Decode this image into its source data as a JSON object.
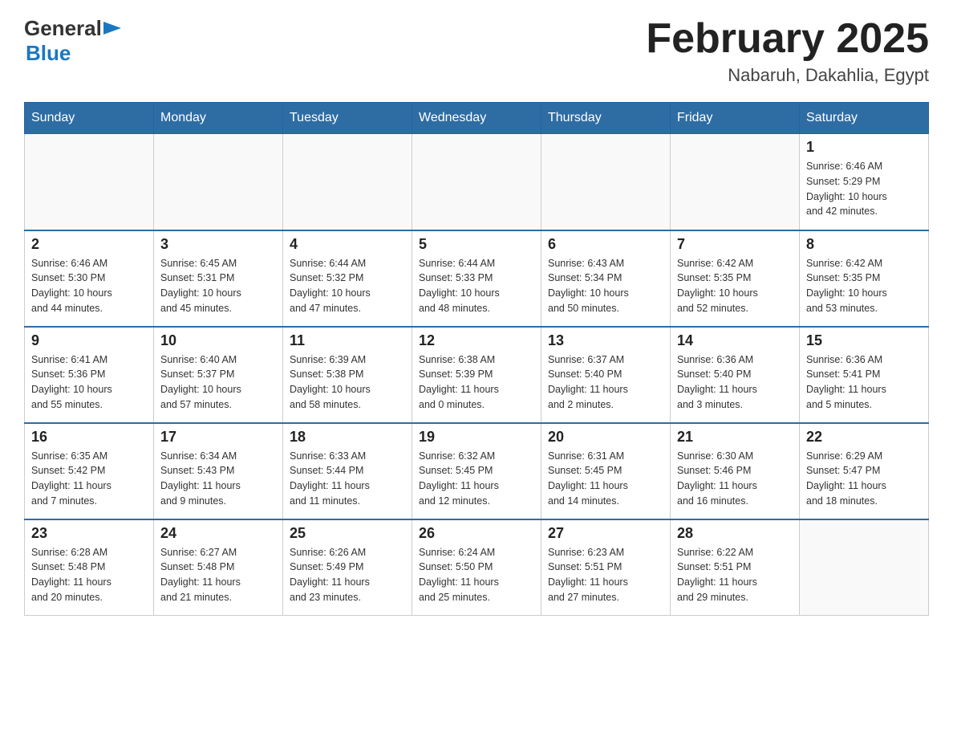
{
  "header": {
    "title": "February 2025",
    "subtitle": "Nabaruh, Dakahlia, Egypt",
    "logo_general": "General",
    "logo_blue": "Blue"
  },
  "days_of_week": [
    "Sunday",
    "Monday",
    "Tuesday",
    "Wednesday",
    "Thursday",
    "Friday",
    "Saturday"
  ],
  "weeks": [
    {
      "cells": [
        {
          "day": "",
          "info": ""
        },
        {
          "day": "",
          "info": ""
        },
        {
          "day": "",
          "info": ""
        },
        {
          "day": "",
          "info": ""
        },
        {
          "day": "",
          "info": ""
        },
        {
          "day": "",
          "info": ""
        },
        {
          "day": "1",
          "info": "Sunrise: 6:46 AM\nSunset: 5:29 PM\nDaylight: 10 hours\nand 42 minutes."
        }
      ]
    },
    {
      "cells": [
        {
          "day": "2",
          "info": "Sunrise: 6:46 AM\nSunset: 5:30 PM\nDaylight: 10 hours\nand 44 minutes."
        },
        {
          "day": "3",
          "info": "Sunrise: 6:45 AM\nSunset: 5:31 PM\nDaylight: 10 hours\nand 45 minutes."
        },
        {
          "day": "4",
          "info": "Sunrise: 6:44 AM\nSunset: 5:32 PM\nDaylight: 10 hours\nand 47 minutes."
        },
        {
          "day": "5",
          "info": "Sunrise: 6:44 AM\nSunset: 5:33 PM\nDaylight: 10 hours\nand 48 minutes."
        },
        {
          "day": "6",
          "info": "Sunrise: 6:43 AM\nSunset: 5:34 PM\nDaylight: 10 hours\nand 50 minutes."
        },
        {
          "day": "7",
          "info": "Sunrise: 6:42 AM\nSunset: 5:35 PM\nDaylight: 10 hours\nand 52 minutes."
        },
        {
          "day": "8",
          "info": "Sunrise: 6:42 AM\nSunset: 5:35 PM\nDaylight: 10 hours\nand 53 minutes."
        }
      ]
    },
    {
      "cells": [
        {
          "day": "9",
          "info": "Sunrise: 6:41 AM\nSunset: 5:36 PM\nDaylight: 10 hours\nand 55 minutes."
        },
        {
          "day": "10",
          "info": "Sunrise: 6:40 AM\nSunset: 5:37 PM\nDaylight: 10 hours\nand 57 minutes."
        },
        {
          "day": "11",
          "info": "Sunrise: 6:39 AM\nSunset: 5:38 PM\nDaylight: 10 hours\nand 58 minutes."
        },
        {
          "day": "12",
          "info": "Sunrise: 6:38 AM\nSunset: 5:39 PM\nDaylight: 11 hours\nand 0 minutes."
        },
        {
          "day": "13",
          "info": "Sunrise: 6:37 AM\nSunset: 5:40 PM\nDaylight: 11 hours\nand 2 minutes."
        },
        {
          "day": "14",
          "info": "Sunrise: 6:36 AM\nSunset: 5:40 PM\nDaylight: 11 hours\nand 3 minutes."
        },
        {
          "day": "15",
          "info": "Sunrise: 6:36 AM\nSunset: 5:41 PM\nDaylight: 11 hours\nand 5 minutes."
        }
      ]
    },
    {
      "cells": [
        {
          "day": "16",
          "info": "Sunrise: 6:35 AM\nSunset: 5:42 PM\nDaylight: 11 hours\nand 7 minutes."
        },
        {
          "day": "17",
          "info": "Sunrise: 6:34 AM\nSunset: 5:43 PM\nDaylight: 11 hours\nand 9 minutes."
        },
        {
          "day": "18",
          "info": "Sunrise: 6:33 AM\nSunset: 5:44 PM\nDaylight: 11 hours\nand 11 minutes."
        },
        {
          "day": "19",
          "info": "Sunrise: 6:32 AM\nSunset: 5:45 PM\nDaylight: 11 hours\nand 12 minutes."
        },
        {
          "day": "20",
          "info": "Sunrise: 6:31 AM\nSunset: 5:45 PM\nDaylight: 11 hours\nand 14 minutes."
        },
        {
          "day": "21",
          "info": "Sunrise: 6:30 AM\nSunset: 5:46 PM\nDaylight: 11 hours\nand 16 minutes."
        },
        {
          "day": "22",
          "info": "Sunrise: 6:29 AM\nSunset: 5:47 PM\nDaylight: 11 hours\nand 18 minutes."
        }
      ]
    },
    {
      "cells": [
        {
          "day": "23",
          "info": "Sunrise: 6:28 AM\nSunset: 5:48 PM\nDaylight: 11 hours\nand 20 minutes."
        },
        {
          "day": "24",
          "info": "Sunrise: 6:27 AM\nSunset: 5:48 PM\nDaylight: 11 hours\nand 21 minutes."
        },
        {
          "day": "25",
          "info": "Sunrise: 6:26 AM\nSunset: 5:49 PM\nDaylight: 11 hours\nand 23 minutes."
        },
        {
          "day": "26",
          "info": "Sunrise: 6:24 AM\nSunset: 5:50 PM\nDaylight: 11 hours\nand 25 minutes."
        },
        {
          "day": "27",
          "info": "Sunrise: 6:23 AM\nSunset: 5:51 PM\nDaylight: 11 hours\nand 27 minutes."
        },
        {
          "day": "28",
          "info": "Sunrise: 6:22 AM\nSunset: 5:51 PM\nDaylight: 11 hours\nand 29 minutes."
        },
        {
          "day": "",
          "info": ""
        }
      ]
    }
  ]
}
